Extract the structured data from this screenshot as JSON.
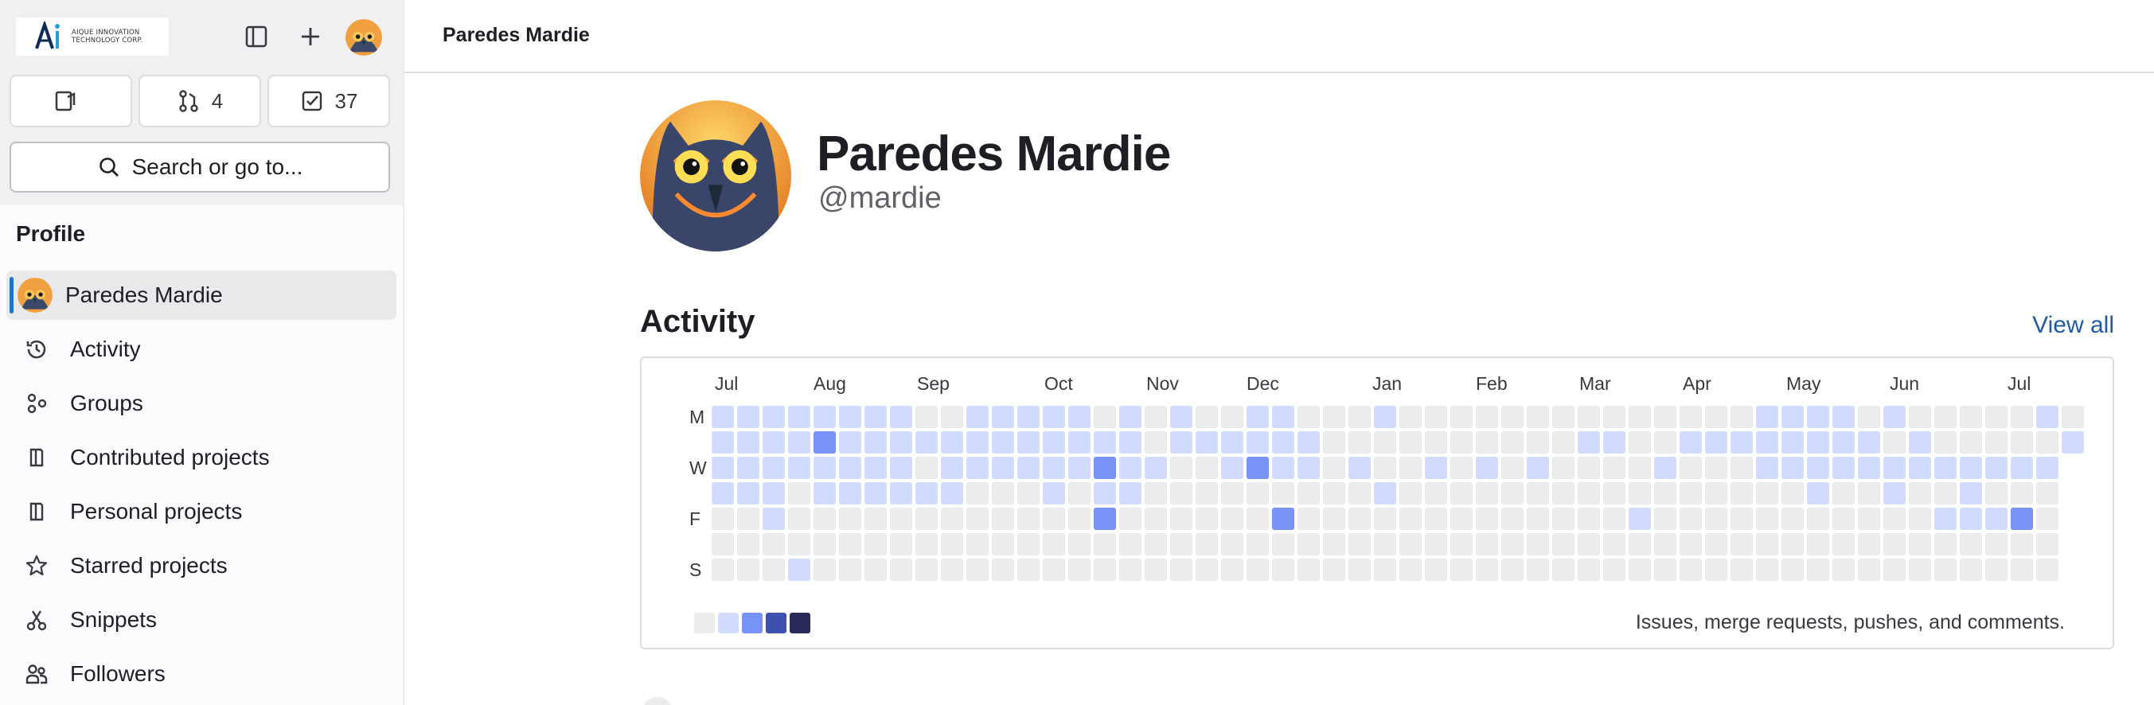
{
  "sidebar": {
    "logo_text": "AIQUE INNOVATION TECHNOLOGY CORP.",
    "counts": {
      "issues": "",
      "merge_requests": "4",
      "todos": "37"
    },
    "search_label": "Search or go to...",
    "section_title": "Profile",
    "items": [
      {
        "label": "Paredes Mardie",
        "icon": "avatar",
        "active": true
      },
      {
        "label": "Activity",
        "icon": "history-icon"
      },
      {
        "label": "Groups",
        "icon": "groups-icon"
      },
      {
        "label": "Contributed projects",
        "icon": "project-icon"
      },
      {
        "label": "Personal projects",
        "icon": "project-icon"
      },
      {
        "label": "Starred projects",
        "icon": "star-icon"
      },
      {
        "label": "Snippets",
        "icon": "snippet-icon"
      },
      {
        "label": "Followers",
        "icon": "users-icon"
      }
    ]
  },
  "header": {
    "breadcrumb": "Paredes Mardie"
  },
  "profile": {
    "name": "Paredes Mardie",
    "handle": "@mardie"
  },
  "activity": {
    "title": "Activity",
    "view_all": "View all",
    "caption": "Issues, merge requests, pushes, and comments.",
    "months": [
      "Jul",
      "Aug",
      "Sep",
      "Oct",
      "Nov",
      "Dec",
      "Jan",
      "Feb",
      "Mar",
      "Apr",
      "May",
      "Jun",
      "Jul"
    ],
    "day_labels": [
      "M",
      "",
      "W",
      "",
      "F",
      "",
      "S"
    ],
    "colors": [
      "#ececef",
      "#d2dcff",
      "#7992f5",
      "#3f51ae",
      "#2a2b59"
    ],
    "grid": [
      "11111111001111101010011000100000000000000111101000001000100000011001100000000000000000000000000",
      "1111211111111111101111110000000000110011111111010000010100110111111111120000000000000000000000",
      "1111111101111112110012110100101010000100011111111111111001112211110021000000000000000000000000",
      "1110111111000101100000000010000000000000000100100100000000110002020020000000000000000000000",
      "0010000000000002000000200000000000001000000000001112000000002100000020000000000000000000000000",
      "0000000000000000000000000000000000000000000000000000000000120000200000000000000000000000000000",
      "0001000000000000000000000000000000000000000000000000000000001000000000000000000000000000000000"
    ]
  }
}
